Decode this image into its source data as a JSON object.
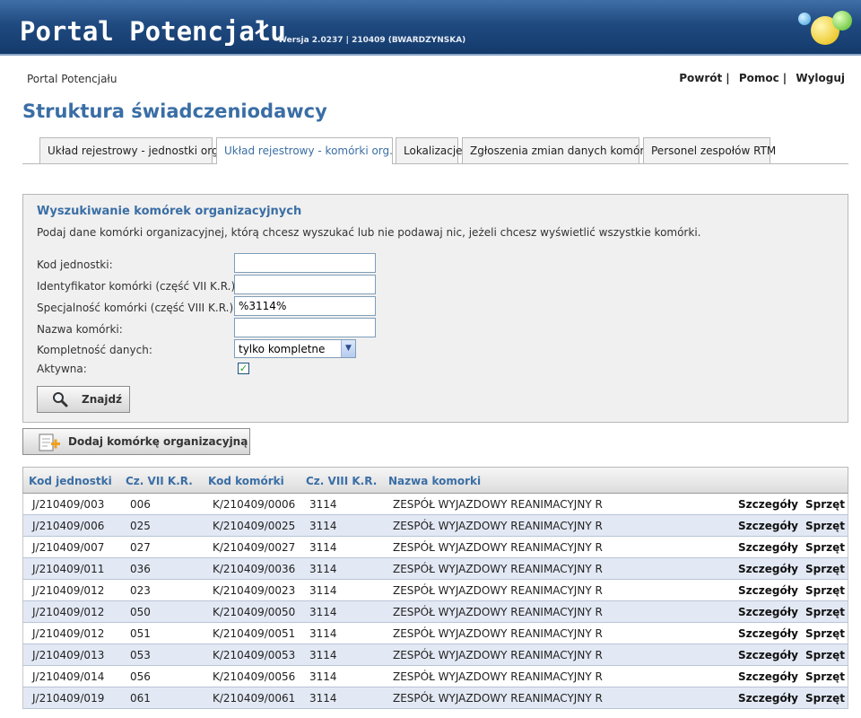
{
  "header": {
    "title": "Portal Potencjału",
    "version": "Wersja 2.0237 | 210409 (BWARDZYNSKA)"
  },
  "breadcrumb": "Portal Potencjału",
  "toplinks": {
    "back": "Powrót",
    "help": "Pomoc",
    "logout": "Wyloguj",
    "separator": "|"
  },
  "page_title": "Struktura świadczeniodawcy",
  "tabs": [
    {
      "label": "Układ rejestrowy - jednostki org."
    },
    {
      "label": "Układ rejestrowy - komórki org."
    },
    {
      "label": "Lokalizacje"
    },
    {
      "label": "Zgłoszenia zmian danych komórek"
    },
    {
      "label": "Personel zespołów RTM"
    }
  ],
  "search": {
    "heading": "Wyszukiwanie komórek organizacyjnych",
    "hint": "Podaj dane komórki organizacyjnej, którą chcesz wyszukać lub nie podawaj nic, jeżeli chcesz wyświetlić wszystkie komórki.",
    "fields": {
      "unit_code": {
        "label": "Kod jednostki:",
        "value": ""
      },
      "cell_id": {
        "label": "Identyfikator komórki (część VII K.R.):",
        "value": ""
      },
      "specialty": {
        "label": "Specjalność komórki (część VIII K.R.):",
        "value": "%3114%"
      },
      "cell_name": {
        "label": "Nazwa komórki:",
        "value": ""
      },
      "completeness": {
        "label": "Kompletność danych:",
        "value": "tylko kompletne"
      },
      "active": {
        "label": "Aktywna:",
        "checked": true
      }
    },
    "find_button": "Znajdź"
  },
  "add_button": "Dodaj komórkę organizacyjną",
  "table": {
    "columns": [
      "Kod jednostki",
      "Cz. VII K.R.",
      "Kod komórki",
      "Cz. VIII K.R.",
      "Nazwa komorki"
    ],
    "action_details": "Szczegóły",
    "action_equipment": "Sprzęt",
    "rows": [
      [
        "J/210409/003",
        "006",
        "K/210409/0006",
        "3114",
        "ZESPÓŁ WYJAZDOWY REANIMACYJNY R"
      ],
      [
        "J/210409/006",
        "025",
        "K/210409/0025",
        "3114",
        "ZESPÓŁ WYJAZDOWY REANIMACYJNY R"
      ],
      [
        "J/210409/007",
        "027",
        "K/210409/0027",
        "3114",
        "ZESPÓŁ WYJAZDOWY REANIMACYJNY R"
      ],
      [
        "J/210409/011",
        "036",
        "K/210409/0036",
        "3114",
        "ZESPÓŁ WYJAZDOWY REANIMACYJNY R"
      ],
      [
        "J/210409/012",
        "023",
        "K/210409/0023",
        "3114",
        "ZESPÓŁ WYJAZDOWY REANIMACYJNY R"
      ],
      [
        "J/210409/012",
        "050",
        "K/210409/0050",
        "3114",
        "ZESPÓŁ WYJAZDOWY REANIMACYJNY R"
      ],
      [
        "J/210409/012",
        "051",
        "K/210409/0051",
        "3114",
        "ZESPÓŁ WYJAZDOWY REANIMACYJNY R"
      ],
      [
        "J/210409/013",
        "053",
        "K/210409/0053",
        "3114",
        "ZESPÓŁ WYJAZDOWY REANIMACYJNY R"
      ],
      [
        "J/210409/014",
        "056",
        "K/210409/0056",
        "3114",
        "ZESPÓŁ WYJAZDOWY REANIMACYJNY R"
      ],
      [
        "J/210409/019",
        "061",
        "K/210409/0061",
        "3114",
        "ZESPÓŁ WYJAZDOWY REANIMACYJNY R"
      ]
    ]
  }
}
